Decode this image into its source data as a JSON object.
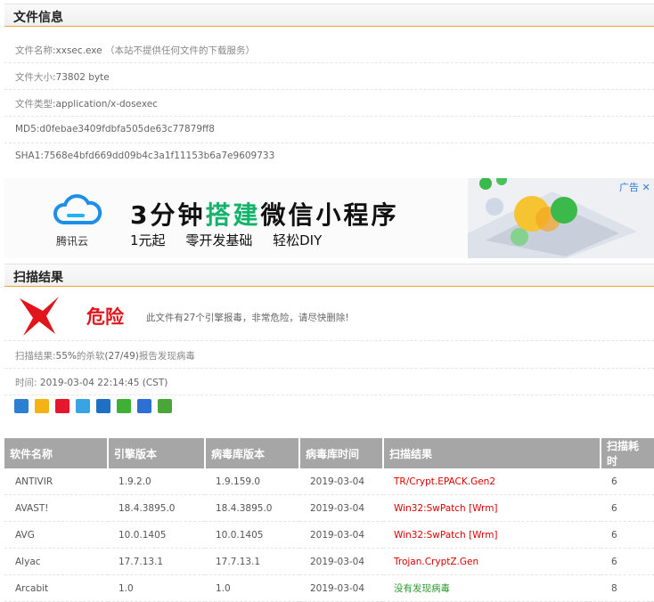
{
  "file_info": {
    "header": "文件信息",
    "name_label": "文件名称",
    "name_value": ":xxsec.exe",
    "name_note": "（本站不提供任何文件的下载服务）",
    "size_label": "文件大小",
    "size_value": ":73802 byte",
    "type_label": "文件类型",
    "type_value": ":application/x-dosexec",
    "md5": "MD5:d0febae3409fdbfa505de63c77879ff8",
    "sha1": "SHA1:7568e4bfd669dd09b4c3a1f11153b6a7e9609733"
  },
  "ad": {
    "brand": "腾讯云",
    "headline_a": "3分钟",
    "headline_b": "搭建",
    "headline_c": "微信小程序",
    "sub1": "1元起",
    "sub2": "零开发基础",
    "sub3": "轻松DIY",
    "tag": "广告",
    "close": "✕"
  },
  "scan": {
    "header": "扫描结果",
    "verdict": "危险",
    "verdict_desc": "此文件有27个引擎报毒，非常危险，请尽快删除!",
    "result_label": "扫描结果:",
    "result_pct": "55%",
    "result_mid": "的杀软",
    "result_ratio": "(27/49)",
    "result_tail": "报告发现病毒",
    "time_label": "时间:",
    "time_value": " 2019-03-04 22:14:45 (CST)"
  },
  "share_icons": [
    {
      "name": "share-plus-icon",
      "color": "#2d7fd3"
    },
    {
      "name": "qzone-icon",
      "color": "#f3b315"
    },
    {
      "name": "weibo-icon",
      "color": "#e6162d"
    },
    {
      "name": "qq-icon",
      "color": "#3aa3e3"
    },
    {
      "name": "renren-icon",
      "color": "#1f6fc2"
    },
    {
      "name": "wechat-icon",
      "color": "#3eb135"
    },
    {
      "name": "tieba-icon",
      "color": "#2e6fd6"
    },
    {
      "name": "douban-icon",
      "color": "#4aa63a"
    }
  ],
  "table": {
    "headers": [
      "软件名称",
      "引擎版本",
      "病毒库版本",
      "病毒库时间",
      "扫描结果",
      "扫描耗时"
    ],
    "rows": [
      {
        "name": "ANTIVIR",
        "engine": "1.9.2.0",
        "db": "1.9.159.0",
        "date": "2019-03-04",
        "result": "TR/Crypt.EPACK.Gen2",
        "status": "bad",
        "time": "6"
      },
      {
        "name": "AVAST!",
        "engine": "18.4.3895.0",
        "db": "18.4.3895.0",
        "date": "2019-03-04",
        "result": "Win32:SwPatch [Wrm]",
        "status": "bad",
        "time": "6"
      },
      {
        "name": "AVG",
        "engine": "10.0.1405",
        "db": "10.0.1405",
        "date": "2019-03-04",
        "result": "Win32:SwPatch [Wrm]",
        "status": "bad",
        "time": "6"
      },
      {
        "name": "Alyac",
        "engine": "17.7.13.1",
        "db": "17.7.13.1",
        "date": "2019-03-04",
        "result": "Trojan.CryptZ.Gen",
        "status": "bad",
        "time": "6"
      },
      {
        "name": "Arcabit",
        "engine": "1.0",
        "db": "1.0",
        "date": "2019-03-04",
        "result": "没有发现病毒",
        "status": "good",
        "time": "8"
      }
    ]
  }
}
